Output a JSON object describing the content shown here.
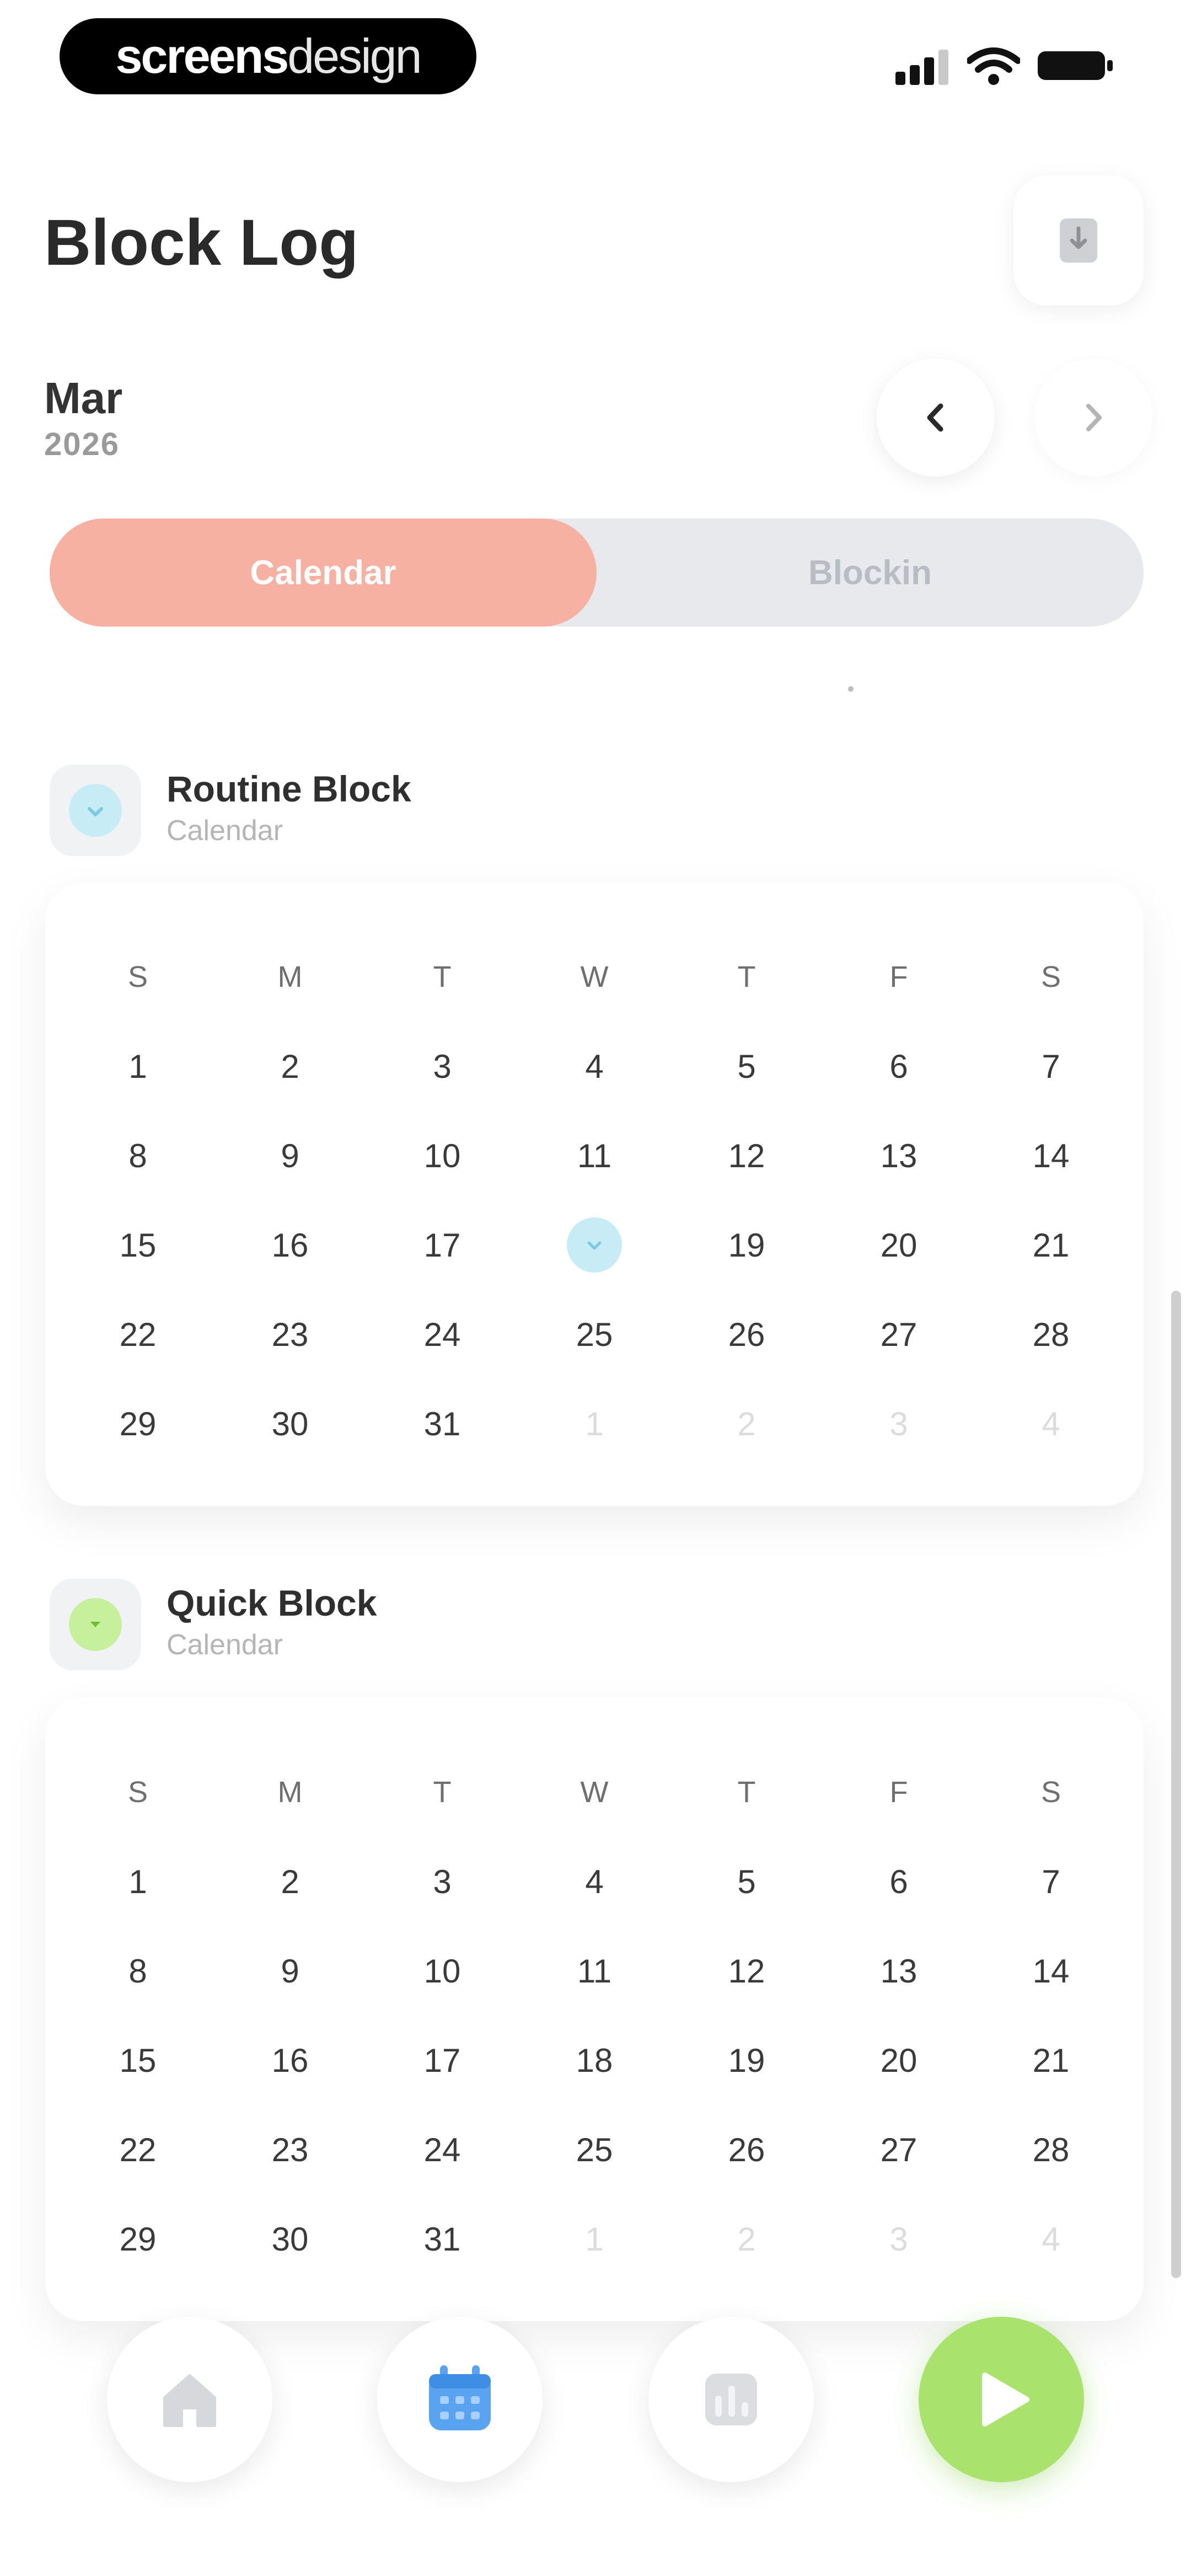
{
  "brand": {
    "part1": "screens",
    "part2": "design"
  },
  "header": {
    "title": "Block Log",
    "export_icon": "export-icon"
  },
  "period": {
    "month": "Mar",
    "year": "2026"
  },
  "segments": {
    "active": "Calendar",
    "inactive": "Blockin"
  },
  "weekdays": [
    "S",
    "M",
    "T",
    "W",
    "T",
    "F",
    "S"
  ],
  "sections": [
    {
      "title": "Routine Block",
      "subtitle": "Calendar",
      "accent": "#9fdcef"
    },
    {
      "title": "Quick Block",
      "subtitle": "Calendar",
      "accent": "#a9e36d"
    }
  ],
  "calendar_days": [
    {
      "label": "1",
      "muted": false
    },
    {
      "label": "2",
      "muted": false
    },
    {
      "label": "3",
      "muted": false
    },
    {
      "label": "4",
      "muted": false
    },
    {
      "label": "5",
      "muted": false
    },
    {
      "label": "6",
      "muted": false
    },
    {
      "label": "7",
      "muted": false
    },
    {
      "label": "8",
      "muted": false
    },
    {
      "label": "9",
      "muted": false
    },
    {
      "label": "10",
      "muted": false
    },
    {
      "label": "11",
      "muted": false
    },
    {
      "label": "12",
      "muted": false
    },
    {
      "label": "13",
      "muted": false
    },
    {
      "label": "14",
      "muted": false
    },
    {
      "label": "15",
      "muted": false
    },
    {
      "label": "16",
      "muted": false
    },
    {
      "label": "17",
      "muted": false
    },
    {
      "label": "18",
      "muted": false
    },
    {
      "label": "19",
      "muted": false
    },
    {
      "label": "20",
      "muted": false
    },
    {
      "label": "21",
      "muted": false
    },
    {
      "label": "22",
      "muted": false
    },
    {
      "label": "23",
      "muted": false
    },
    {
      "label": "24",
      "muted": false
    },
    {
      "label": "25",
      "muted": false
    },
    {
      "label": "26",
      "muted": false
    },
    {
      "label": "27",
      "muted": false
    },
    {
      "label": "28",
      "muted": false
    },
    {
      "label": "29",
      "muted": false
    },
    {
      "label": "30",
      "muted": false
    },
    {
      "label": "31",
      "muted": false
    },
    {
      "label": "1",
      "muted": true
    },
    {
      "label": "2",
      "muted": true
    },
    {
      "label": "3",
      "muted": true
    },
    {
      "label": "4",
      "muted": true
    }
  ],
  "routine_marked_day": "18",
  "tabs": [
    {
      "name": "home",
      "icon": "home-icon"
    },
    {
      "name": "calendar",
      "icon": "calendar-icon"
    },
    {
      "name": "stats",
      "icon": "stats-icon"
    },
    {
      "name": "start",
      "icon": "play-icon"
    }
  ],
  "colors": {
    "segment_active": "#f6b1a2",
    "routine_accent": "#9fdcef",
    "quick_accent": "#a9e36d",
    "calendar_tab": "#5aa3f0"
  }
}
